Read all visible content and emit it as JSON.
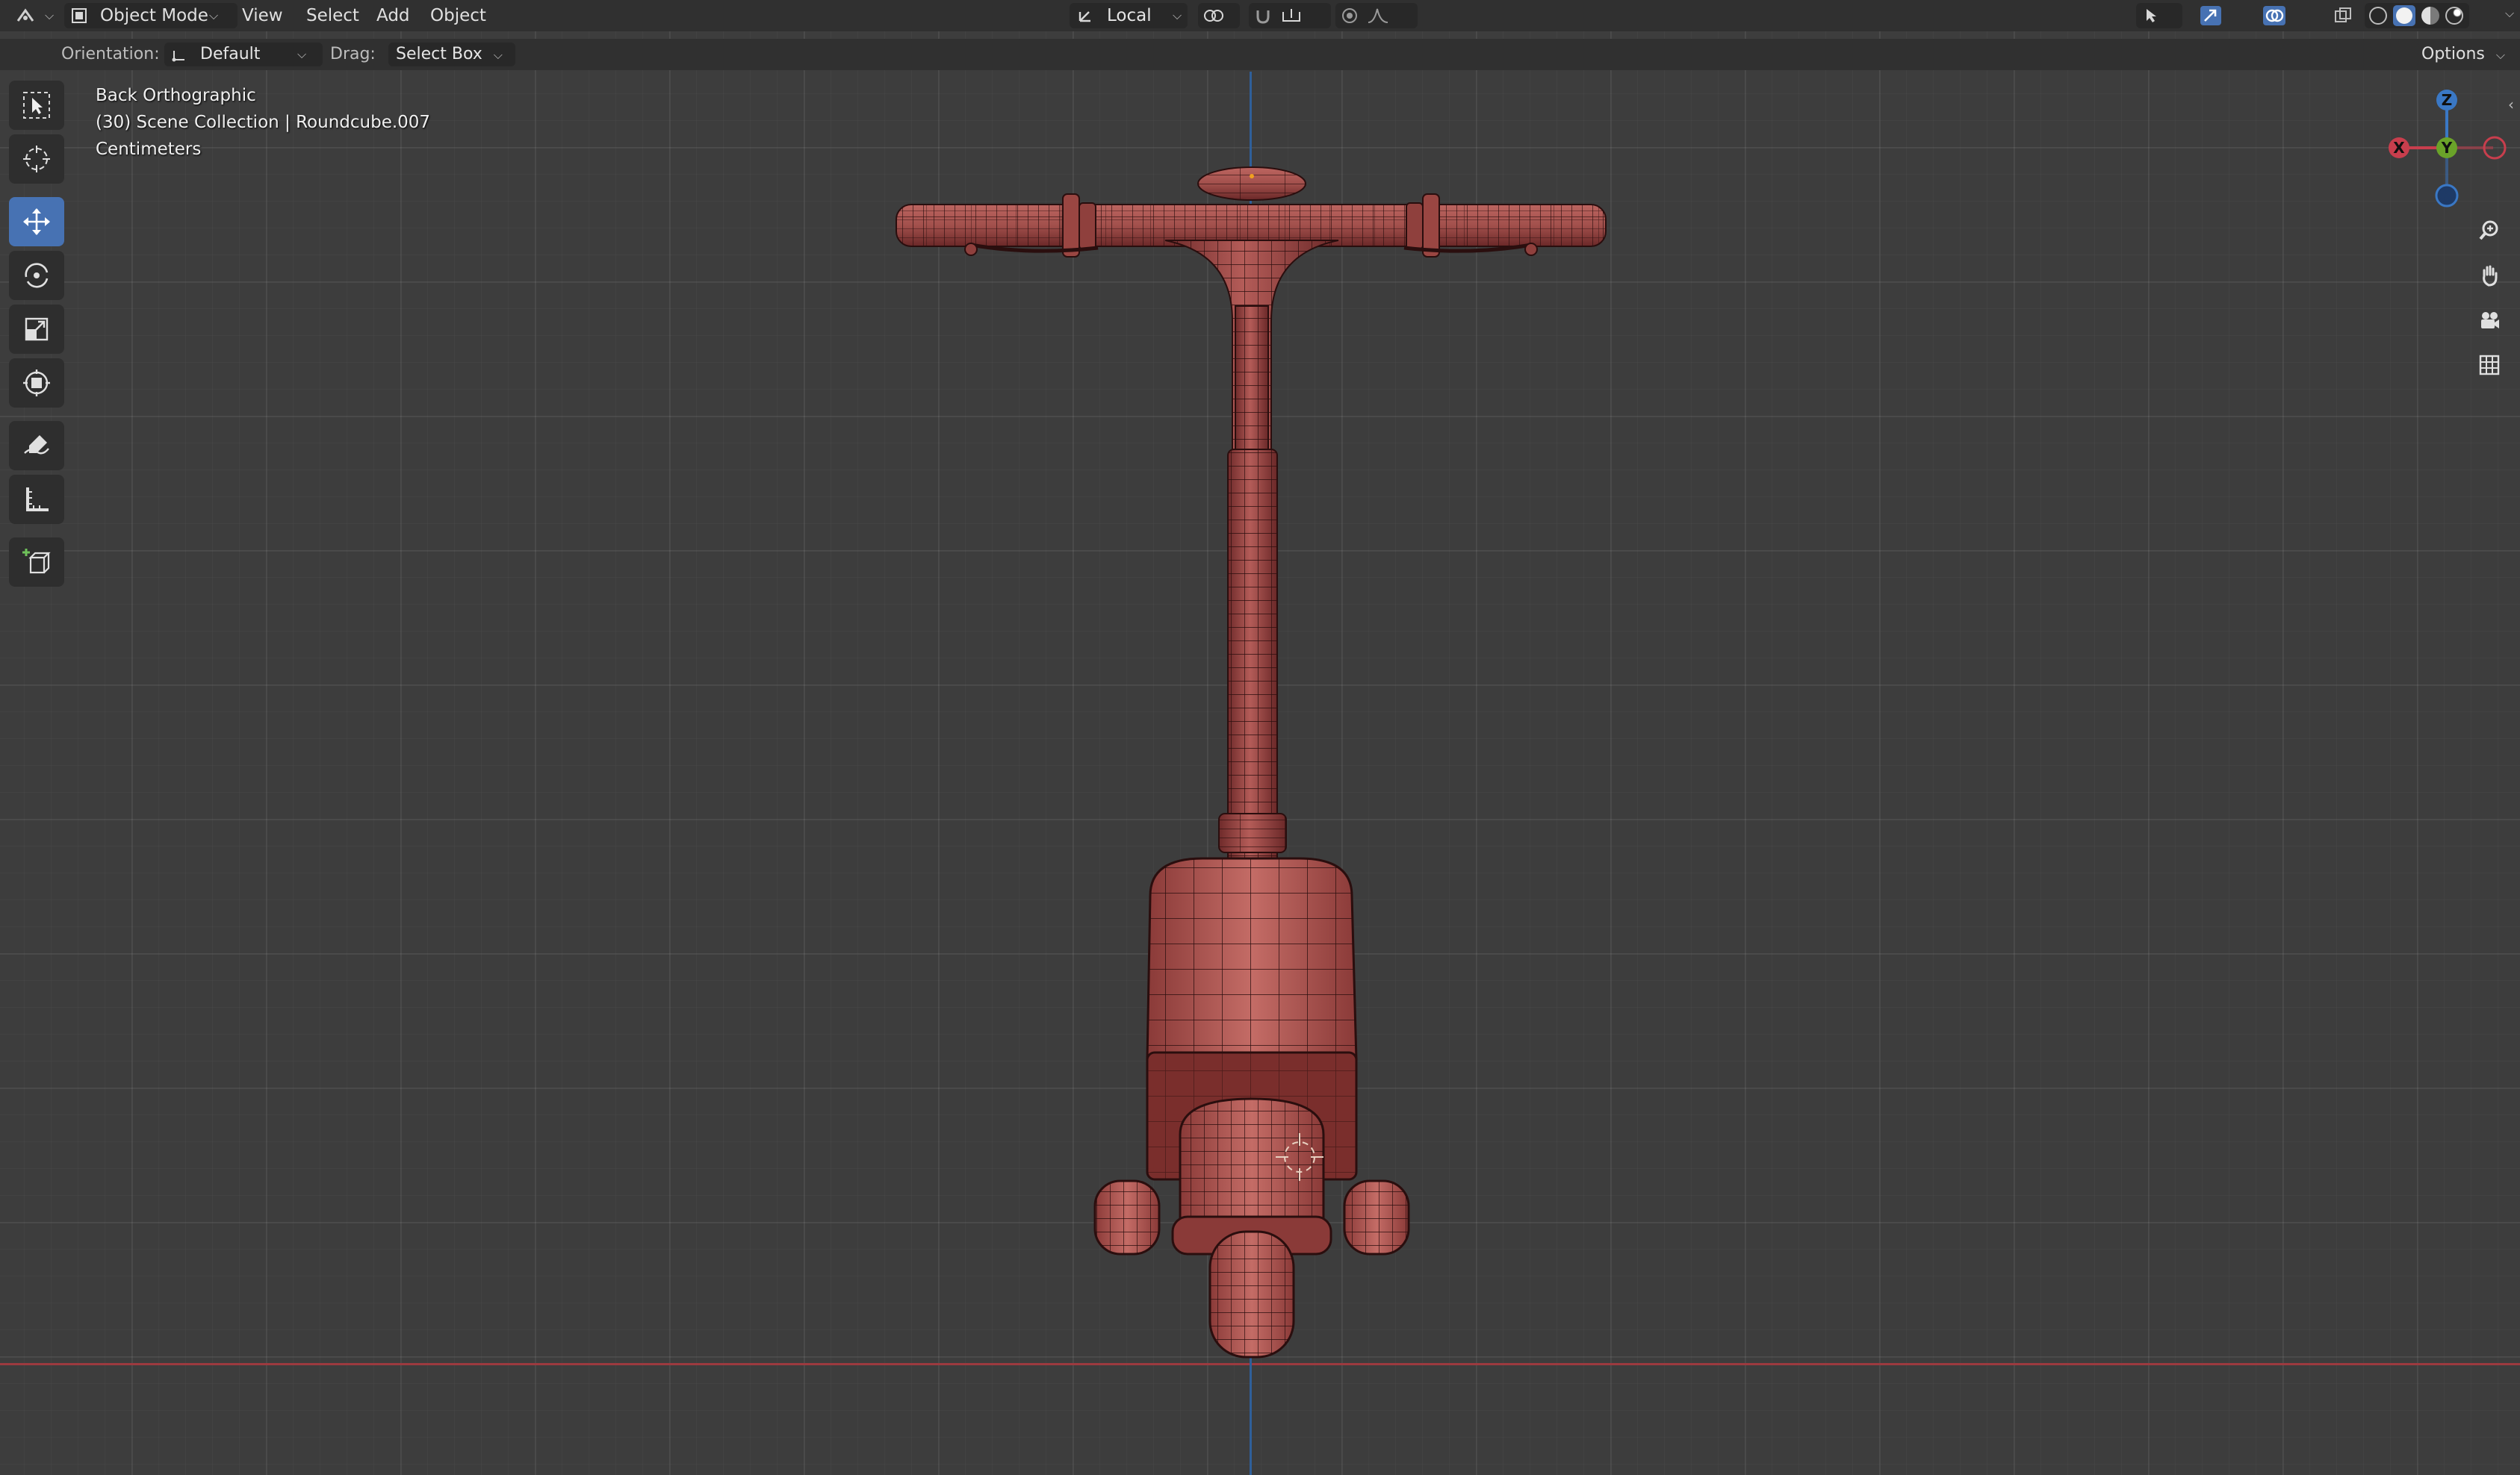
{
  "header": {
    "mode_label": "Object Mode",
    "menu": [
      "View",
      "Select",
      "Add",
      "Object"
    ],
    "transform_orientation": "Local",
    "shading": "solid"
  },
  "tool_settings": {
    "orientation_label": "Orientation:",
    "orientation_value": "Default",
    "drag_label": "Drag:",
    "drag_value": "Select Box",
    "options_label": "Options"
  },
  "toolbar": {
    "tools": [
      "select-box",
      "cursor",
      "move",
      "rotate",
      "scale",
      "transform",
      "annotate",
      "measure",
      "add-cube"
    ],
    "active_tool": "move"
  },
  "viewport": {
    "view_name": "Back Orthographic",
    "collection_line": "(30) Scene Collection | Roundcube.007",
    "units": "Centimeters"
  },
  "gizmo": {
    "z": "Z",
    "y": "Y",
    "x": "X"
  },
  "colors": {
    "x_axis": "#c83e4d",
    "y_axis": "#6aa329",
    "z_axis": "#3a78c5",
    "active_tool": "#4772b3",
    "model": "#a84a48"
  }
}
